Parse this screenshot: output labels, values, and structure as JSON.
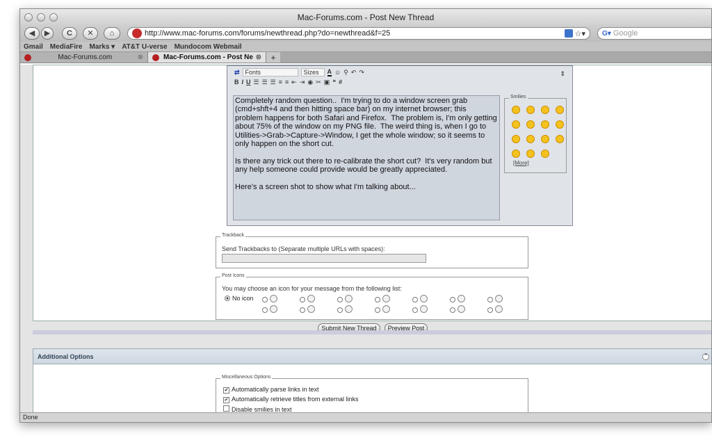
{
  "window": {
    "title": "Mac-Forums.com - Post New Thread",
    "status": "Done"
  },
  "toolbar": {
    "back": "◀",
    "forward": "▶",
    "reload": "C",
    "stop": "✕",
    "home": "⌂",
    "url": "http://www.mac-forums.com/forums/newthread.php?do=newthread&f=25",
    "star_glyph": "☆▾",
    "search_engine_glyph": "G▾",
    "search_placeholder": "Google"
  },
  "bookmarks": [
    "Gmail",
    "MediaFire",
    "Marks ▾",
    "AT&T U-verse",
    "Mundocom Webmail"
  ],
  "tabs": [
    {
      "title": "Mac-Forums.com",
      "close": "⊗"
    },
    {
      "title": "Mac-Forums.com - Post New T…",
      "close": "⊗"
    }
  ],
  "add_tab_glyph": "+",
  "editor": {
    "toolbar": {
      "font": "Fonts",
      "size": "Sizes",
      "bold": "B",
      "italic": "I",
      "underline": "U",
      "text_color_glyph": "A",
      "hash": "#"
    },
    "text": "Completely random question..  I'm trying to do a window screen grab\n(cmd+shft+4 and then hitting space bar) on my internet browser; this\nproblem happens for both Safari and Firefox.  The problem is, I'm only getting\nabout 75% of the window on my PNG file.  The weird thing is, when I go to\nUtilities->Grab->Capture->Window, I get the whole window; so it seems to\nonly happen on the short cut.\n\nIs there any trick out there to re-calibrate the short cut?  It's very random but\nany help someone could provide would be greatly appreciated.\n\nHere's a screen shot to show what I'm talking about...",
    "smilies_title": "Smilies",
    "more": "[More]"
  },
  "trackback": {
    "legend": "Trackback",
    "label": "Send Trackbacks to (Separate multiple URLs with spaces):"
  },
  "post_icons": {
    "legend": "Post Icons",
    "label": "You may choose an icon for your message from the following list:",
    "no_icon": "No icon"
  },
  "buttons": {
    "submit": "Submit New Thread",
    "preview": "Preview Post"
  },
  "additional": {
    "title": "Additional Options",
    "misc_legend": "Miscellaneous Options",
    "options": [
      {
        "label": "Automatically parse links in text",
        "checked": true
      },
      {
        "label": "Automatically retrieve titles from external links",
        "checked": true
      },
      {
        "label": "Disable smilies in text",
        "checked": false
      }
    ]
  }
}
